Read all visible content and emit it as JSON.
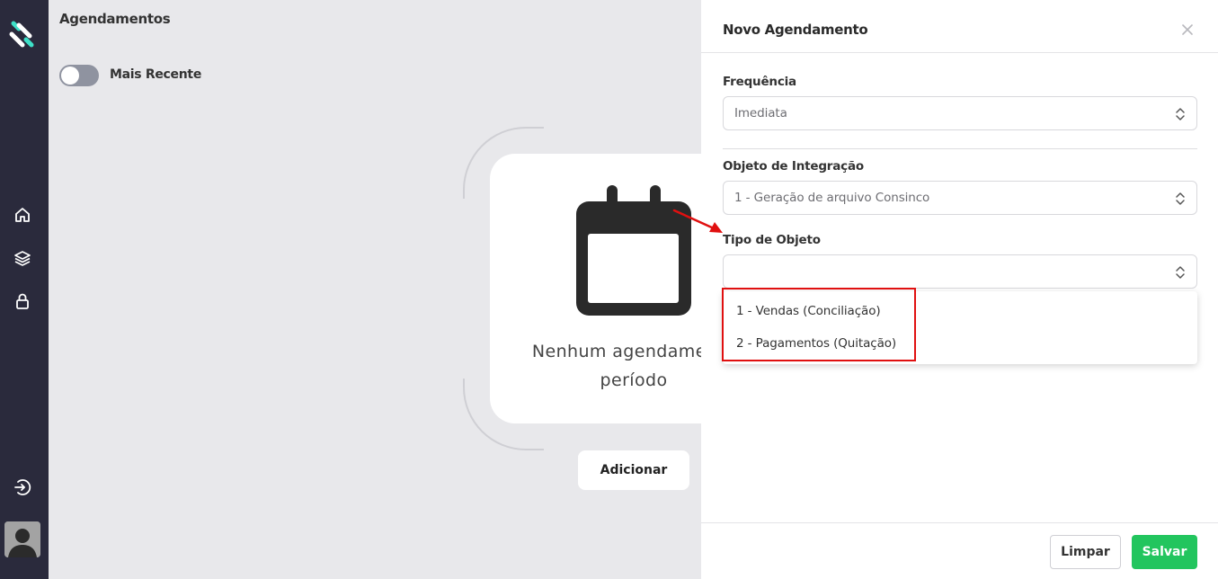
{
  "colors": {
    "sidebar": "#2a2a3c",
    "accent_logo": "#3ee0c8",
    "save": "#22c55e",
    "highlight": "#e01010"
  },
  "sidebar": {
    "logo": "app-logo",
    "items": [
      {
        "icon": "home-icon"
      },
      {
        "icon": "layers-icon"
      },
      {
        "icon": "lock-icon"
      }
    ],
    "logout_icon": "logout-icon",
    "avatar_icon": "user-avatar-icon"
  },
  "main": {
    "title": "Agendamentos",
    "toggle_label": "Mais Recente",
    "empty_state": {
      "icon": "calendar-icon",
      "line1": "Nenhum agendamento",
      "line2": "período"
    },
    "add_button": "Adicionar"
  },
  "drawer": {
    "title": "Novo Agendamento",
    "close_icon": "close-icon",
    "frequency": {
      "label": "Frequência",
      "value": "Imediata"
    },
    "integration_object": {
      "label": "Objeto de Integração",
      "value": "1 - Geração de arquivo Consinco"
    },
    "object_type": {
      "label": "Tipo de Objeto",
      "value": "",
      "options": [
        "1 - Vendas (Conciliação)",
        "2 - Pagamentos (Quitação)"
      ]
    },
    "clear_button": "Limpar",
    "save_button": "Salvar"
  }
}
